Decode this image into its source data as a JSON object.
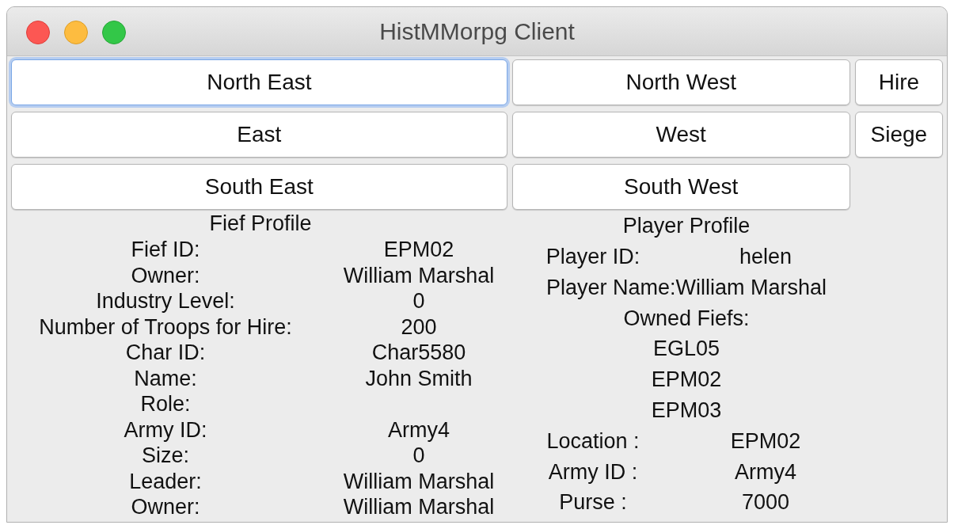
{
  "window": {
    "title": "HistMMorpg Client"
  },
  "button_columns": [
    {
      "buttons": [
        {
          "label": "North East",
          "focused": true
        },
        {
          "label": "East",
          "focused": false
        },
        {
          "label": "South East",
          "focused": false
        }
      ]
    },
    {
      "buttons": [
        {
          "label": "North West",
          "focused": false
        },
        {
          "label": "West",
          "focused": false
        },
        {
          "label": "South West",
          "focused": false
        }
      ]
    },
    {
      "buttons": [
        {
          "label": "Hire",
          "focused": false
        },
        {
          "label": "Siege",
          "focused": false
        }
      ]
    }
  ],
  "fief_profile": {
    "title": "Fief Profile",
    "rows": [
      {
        "label": "Fief ID:",
        "value": "EPM02"
      },
      {
        "label": "Owner:",
        "value": "William Marshal"
      },
      {
        "label": "Industry Level:",
        "value": "0"
      },
      {
        "label": "Number of Troops for Hire:",
        "value": "200"
      },
      {
        "label": "Char ID:",
        "value": "Char5580"
      },
      {
        "label": "Name:",
        "value": "John Smith"
      },
      {
        "label": "Role:"
      },
      {
        "label": "Army ID:",
        "value": "Army4"
      },
      {
        "label": "Size:",
        "value": "0"
      },
      {
        "label": "Leader:",
        "value": "William Marshal"
      },
      {
        "label": "Owner:",
        "value": "William Marshal"
      }
    ]
  },
  "player_profile": {
    "title": "Player Profile",
    "rows": [
      {
        "kind": "pair",
        "label": "Player ID:",
        "value": "helen"
      },
      {
        "kind": "joined",
        "label": "Player Name:",
        "value": "William Marshal"
      },
      {
        "kind": "single",
        "text": "Owned Fiefs:"
      },
      {
        "kind": "single",
        "text": "EGL05"
      },
      {
        "kind": "single",
        "text": "EPM02"
      },
      {
        "kind": "single",
        "text": "EPM03"
      },
      {
        "kind": "pair",
        "label": "Location :",
        "value": "EPM02"
      },
      {
        "kind": "pair",
        "label": "Army ID :",
        "value": "Army4"
      },
      {
        "kind": "pair",
        "label": "Purse :",
        "value": "7000"
      }
    ]
  }
}
